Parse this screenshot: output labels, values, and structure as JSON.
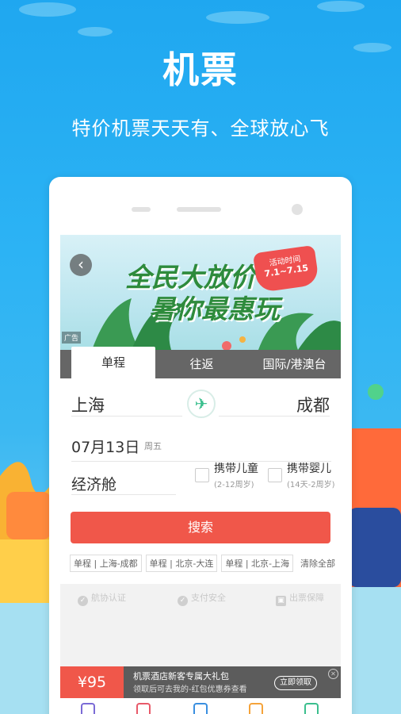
{
  "hero": {
    "title": "机票",
    "subtitle": "特价机票天天有、全球放心飞"
  },
  "banner": {
    "headline_line1": "全民大放价",
    "headline_line2": "暑你最惠玩",
    "promo_label": "活动时间",
    "promo_dates": "7.1~7.15",
    "ad_tag": "广告"
  },
  "tabs": [
    {
      "label": "单程",
      "active": true
    },
    {
      "label": "往返",
      "active": false
    },
    {
      "label": "国际/港澳台",
      "active": false
    }
  ],
  "route": {
    "from": "上海",
    "to": "成都",
    "swap_icon": "airplane-icon"
  },
  "date": {
    "value": "07月13日",
    "weekday": "周五"
  },
  "cabin": "经济舱",
  "passengers": {
    "child_label": "携带儿童",
    "child_note": "(2-12周岁)",
    "infant_label": "携带婴儿",
    "infant_note": "(14天-2周岁)"
  },
  "search_button": "搜索",
  "history": {
    "items": [
      "单程 | 上海-成都",
      "单程 | 北京-大连",
      "单程 | 北京-上海"
    ],
    "clear_label": "清除全部"
  },
  "trust": [
    {
      "label": "航协认证",
      "icon": "check-circle-icon"
    },
    {
      "label": "支付安全",
      "icon": "shield-icon"
    },
    {
      "label": "出票保障",
      "icon": "ticket-icon"
    }
  ],
  "coupon": {
    "amount": "¥95",
    "title": "机票酒店新客专属大礼包",
    "note": "领取后可去我的-红包优惠券查看",
    "button": "立即领取",
    "close_icon": "close-icon"
  },
  "colors": {
    "background": "#2cb3f4",
    "accent_red": "#f0574a",
    "green": "#3bbf8e",
    "tab_bar": "#666666"
  }
}
